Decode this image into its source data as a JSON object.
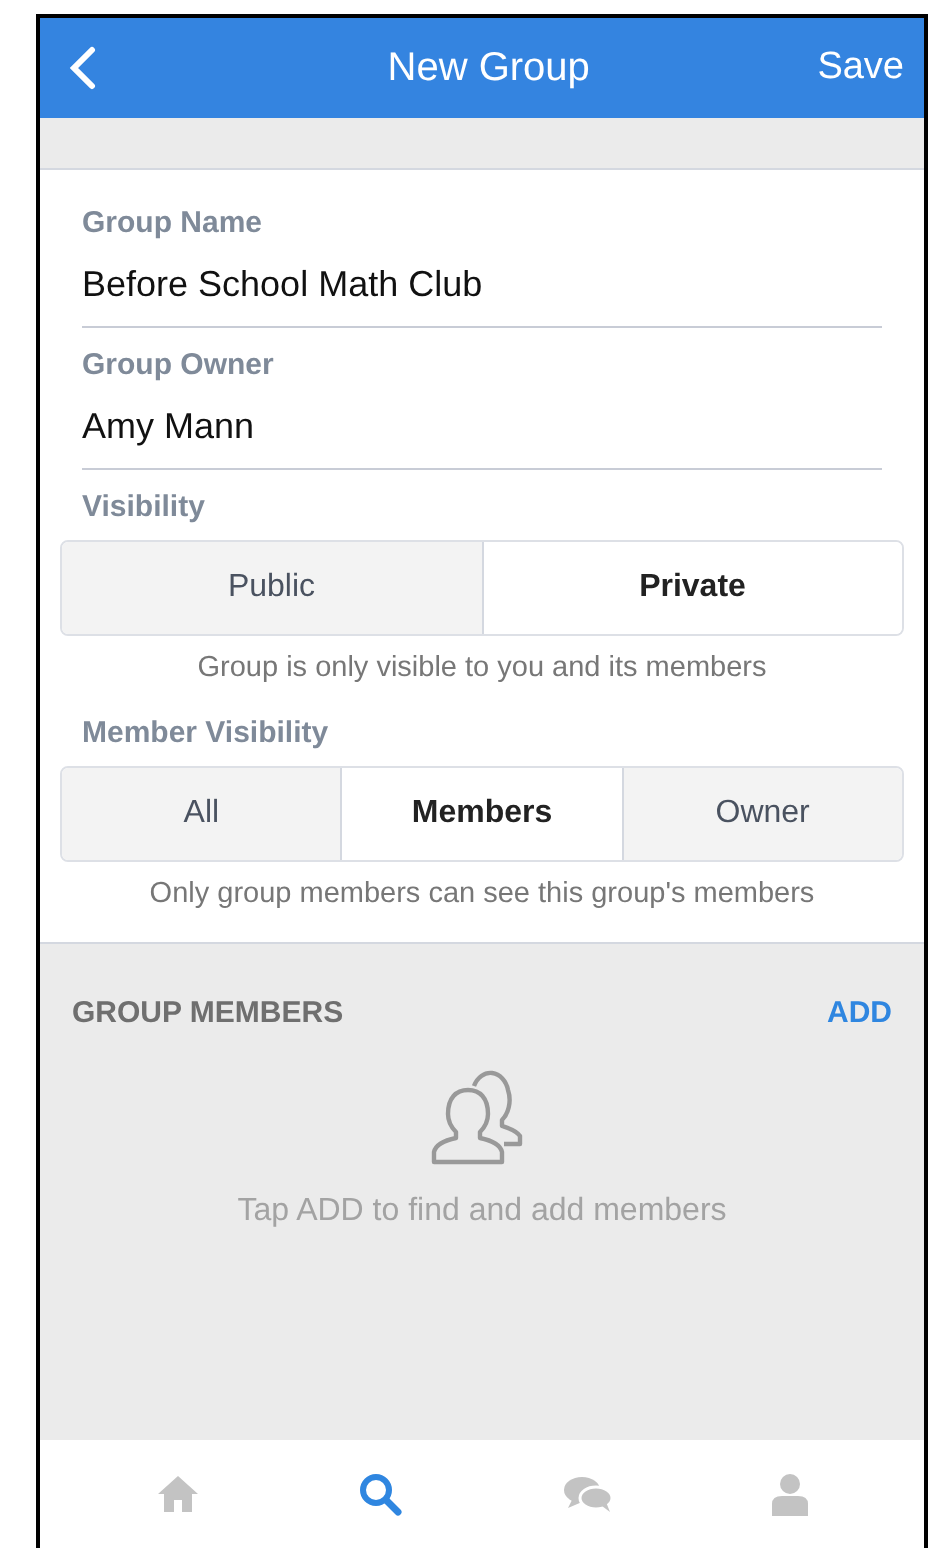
{
  "header": {
    "title": "New Group",
    "action": "Save"
  },
  "fields": [
    {
      "label": "Group Name",
      "value": "Before School Math Club"
    },
    {
      "label": "Group Owner",
      "value": "Amy Mann"
    }
  ],
  "segments": [
    {
      "label": "Visibility",
      "options": [
        {
          "label": "Public",
          "selected": false
        },
        {
          "label": "Private",
          "selected": true
        }
      ],
      "hint": "Group is only visible to you and its members"
    },
    {
      "label": "Member Visibility",
      "options": [
        {
          "label": "All",
          "selected": false
        },
        {
          "label": "Members",
          "selected": true
        },
        {
          "label": "Owner",
          "selected": false
        }
      ],
      "hint": "Only group members can see this group's members"
    }
  ],
  "members": {
    "heading": "GROUP MEMBERS",
    "action": "ADD",
    "empty_text": "Tap ADD to find and add members"
  },
  "tab_bar": [
    {
      "kind": "home",
      "selected": false
    },
    {
      "kind": "search",
      "selected": true
    },
    {
      "kind": "chat",
      "selected": false
    },
    {
      "kind": "profile",
      "selected": false
    }
  ]
}
